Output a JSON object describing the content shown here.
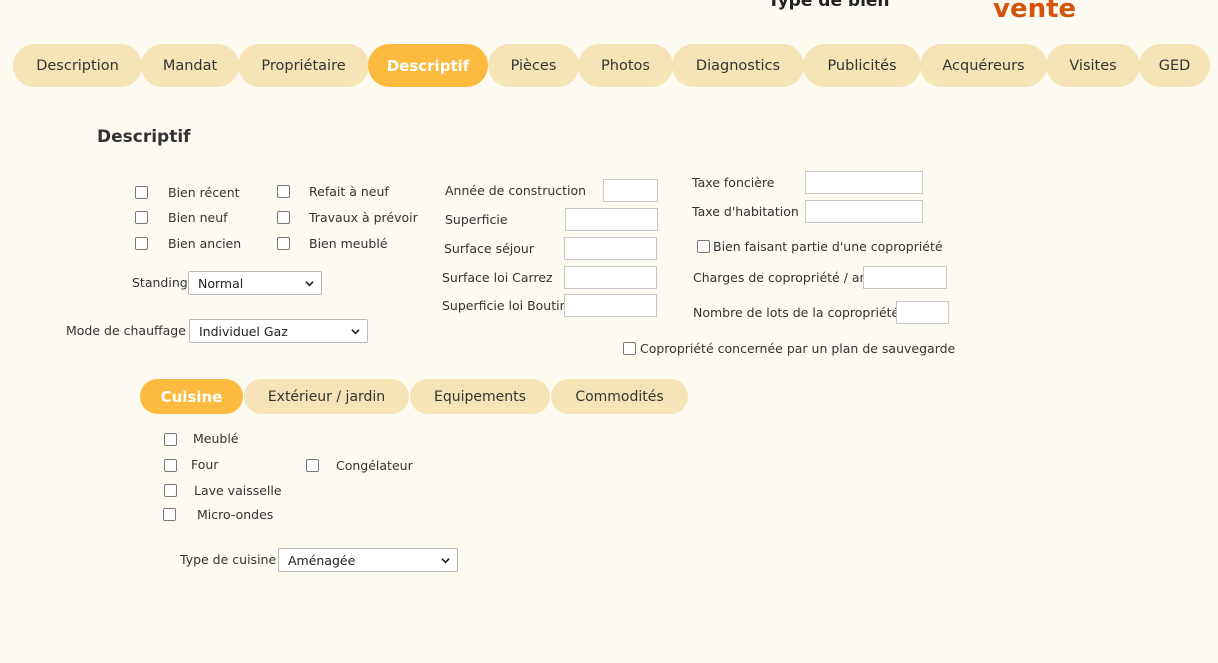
{
  "header": {
    "type_label": "Type de bien",
    "transaction": "vente"
  },
  "tabs": [
    "Description",
    "Mandat",
    "Propriétaire",
    "Descriptif",
    "Pièces",
    "Photos",
    "Diagnostics",
    "Publicités",
    "Acquéreurs",
    "Visites",
    "GED"
  ],
  "active_tab": "Descriptif",
  "section_title": "Descriptif",
  "checkboxes_state": {
    "bien_recent": "Bien récent",
    "refait_neuf": "Refait à neuf",
    "bien_neuf": "Bien neuf",
    "travaux": "Travaux à prévoir",
    "bien_ancien": "Bien ancien",
    "bien_meuble": "Bien meublé"
  },
  "standing": {
    "label": "Standing",
    "value": "Normal"
  },
  "chauffage": {
    "label": "Mode de chauffage",
    "value": "Individuel Gaz"
  },
  "middle_fields": {
    "annee": "Année de construction",
    "superficie": "Superficie",
    "sejour": "Surface séjour",
    "carrez": "Surface loi Carrez",
    "boutin": "Superficie loi Boutin"
  },
  "right_fields": {
    "taxe_fonciere": "Taxe foncière",
    "taxe_habitation": "Taxe d'habitation",
    "copro_check": "Bien faisant partie d'une copropriété",
    "charges": "Charges de copropriété / an",
    "lots": "Nombre de lots de la copropriété",
    "sauvegarde": "Copropriété concernée par un plan de sauvegarde"
  },
  "subtabs": [
    "Cuisine",
    "Extérieur / jardin",
    "Equipements",
    "Commodités"
  ],
  "active_subtab": "Cuisine",
  "kitchen": {
    "meuble": "Meublé",
    "four": "Four",
    "congelateur": "Congélateur",
    "lave_vaisselle": "Lave vaisselle",
    "micro_ondes": "Micro-ondes"
  },
  "type_cuisine": {
    "label": "Type de cuisine",
    "value": "Aménagée"
  },
  "colors": {
    "accent": "#fcbb3e",
    "tab": "#f6e4b7",
    "brand": "#d4540e",
    "background": "#fdfaf2"
  }
}
